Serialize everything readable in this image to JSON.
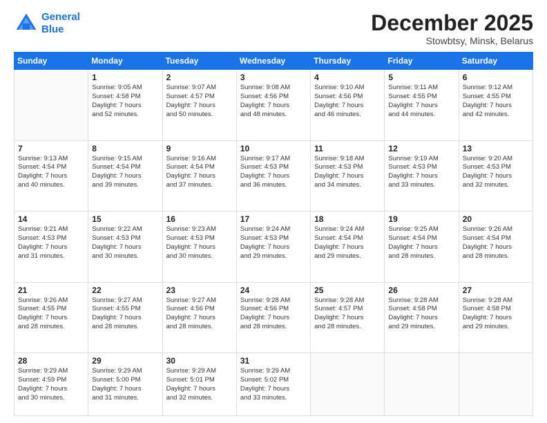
{
  "logo": {
    "line1": "General",
    "line2": "Blue"
  },
  "header": {
    "month": "December 2025",
    "location": "Stowbtsy, Minsk, Belarus"
  },
  "weekdays": [
    "Sunday",
    "Monday",
    "Tuesday",
    "Wednesday",
    "Thursday",
    "Friday",
    "Saturday"
  ],
  "weeks": [
    [
      {
        "day": "",
        "info": ""
      },
      {
        "day": "1",
        "info": "Sunrise: 9:05 AM\nSunset: 4:58 PM\nDaylight: 7 hours\nand 52 minutes."
      },
      {
        "day": "2",
        "info": "Sunrise: 9:07 AM\nSunset: 4:57 PM\nDaylight: 7 hours\nand 50 minutes."
      },
      {
        "day": "3",
        "info": "Sunrise: 9:08 AM\nSunset: 4:56 PM\nDaylight: 7 hours\nand 48 minutes."
      },
      {
        "day": "4",
        "info": "Sunrise: 9:10 AM\nSunset: 4:56 PM\nDaylight: 7 hours\nand 46 minutes."
      },
      {
        "day": "5",
        "info": "Sunrise: 9:11 AM\nSunset: 4:55 PM\nDaylight: 7 hours\nand 44 minutes."
      },
      {
        "day": "6",
        "info": "Sunrise: 9:12 AM\nSunset: 4:55 PM\nDaylight: 7 hours\nand 42 minutes."
      }
    ],
    [
      {
        "day": "7",
        "info": "Sunrise: 9:13 AM\nSunset: 4:54 PM\nDaylight: 7 hours\nand 40 minutes."
      },
      {
        "day": "8",
        "info": "Sunrise: 9:15 AM\nSunset: 4:54 PM\nDaylight: 7 hours\nand 39 minutes."
      },
      {
        "day": "9",
        "info": "Sunrise: 9:16 AM\nSunset: 4:54 PM\nDaylight: 7 hours\nand 37 minutes."
      },
      {
        "day": "10",
        "info": "Sunrise: 9:17 AM\nSunset: 4:53 PM\nDaylight: 7 hours\nand 36 minutes."
      },
      {
        "day": "11",
        "info": "Sunrise: 9:18 AM\nSunset: 4:53 PM\nDaylight: 7 hours\nand 34 minutes."
      },
      {
        "day": "12",
        "info": "Sunrise: 9:19 AM\nSunset: 4:53 PM\nDaylight: 7 hours\nand 33 minutes."
      },
      {
        "day": "13",
        "info": "Sunrise: 9:20 AM\nSunset: 4:53 PM\nDaylight: 7 hours\nand 32 minutes."
      }
    ],
    [
      {
        "day": "14",
        "info": "Sunrise: 9:21 AM\nSunset: 4:53 PM\nDaylight: 7 hours\nand 31 minutes."
      },
      {
        "day": "15",
        "info": "Sunrise: 9:22 AM\nSunset: 4:53 PM\nDaylight: 7 hours\nand 30 minutes."
      },
      {
        "day": "16",
        "info": "Sunrise: 9:23 AM\nSunset: 4:53 PM\nDaylight: 7 hours\nand 30 minutes."
      },
      {
        "day": "17",
        "info": "Sunrise: 9:24 AM\nSunset: 4:53 PM\nDaylight: 7 hours\nand 29 minutes."
      },
      {
        "day": "18",
        "info": "Sunrise: 9:24 AM\nSunset: 4:54 PM\nDaylight: 7 hours\nand 29 minutes."
      },
      {
        "day": "19",
        "info": "Sunrise: 9:25 AM\nSunset: 4:54 PM\nDaylight: 7 hours\nand 28 minutes."
      },
      {
        "day": "20",
        "info": "Sunrise: 9:26 AM\nSunset: 4:54 PM\nDaylight: 7 hours\nand 28 minutes."
      }
    ],
    [
      {
        "day": "21",
        "info": "Sunrise: 9:26 AM\nSunset: 4:55 PM\nDaylight: 7 hours\nand 28 minutes."
      },
      {
        "day": "22",
        "info": "Sunrise: 9:27 AM\nSunset: 4:55 PM\nDaylight: 7 hours\nand 28 minutes."
      },
      {
        "day": "23",
        "info": "Sunrise: 9:27 AM\nSunset: 4:56 PM\nDaylight: 7 hours\nand 28 minutes."
      },
      {
        "day": "24",
        "info": "Sunrise: 9:28 AM\nSunset: 4:56 PM\nDaylight: 7 hours\nand 28 minutes."
      },
      {
        "day": "25",
        "info": "Sunrise: 9:28 AM\nSunset: 4:57 PM\nDaylight: 7 hours\nand 28 minutes."
      },
      {
        "day": "26",
        "info": "Sunrise: 9:28 AM\nSunset: 4:58 PM\nDaylight: 7 hours\nand 29 minutes."
      },
      {
        "day": "27",
        "info": "Sunrise: 9:28 AM\nSunset: 4:58 PM\nDaylight: 7 hours\nand 29 minutes."
      }
    ],
    [
      {
        "day": "28",
        "info": "Sunrise: 9:29 AM\nSunset: 4:59 PM\nDaylight: 7 hours\nand 30 minutes."
      },
      {
        "day": "29",
        "info": "Sunrise: 9:29 AM\nSunset: 5:00 PM\nDaylight: 7 hours\nand 31 minutes."
      },
      {
        "day": "30",
        "info": "Sunrise: 9:29 AM\nSunset: 5:01 PM\nDaylight: 7 hours\nand 32 minutes."
      },
      {
        "day": "31",
        "info": "Sunrise: 9:29 AM\nSunset: 5:02 PM\nDaylight: 7 hours\nand 33 minutes."
      },
      {
        "day": "",
        "info": ""
      },
      {
        "day": "",
        "info": ""
      },
      {
        "day": "",
        "info": ""
      }
    ]
  ]
}
